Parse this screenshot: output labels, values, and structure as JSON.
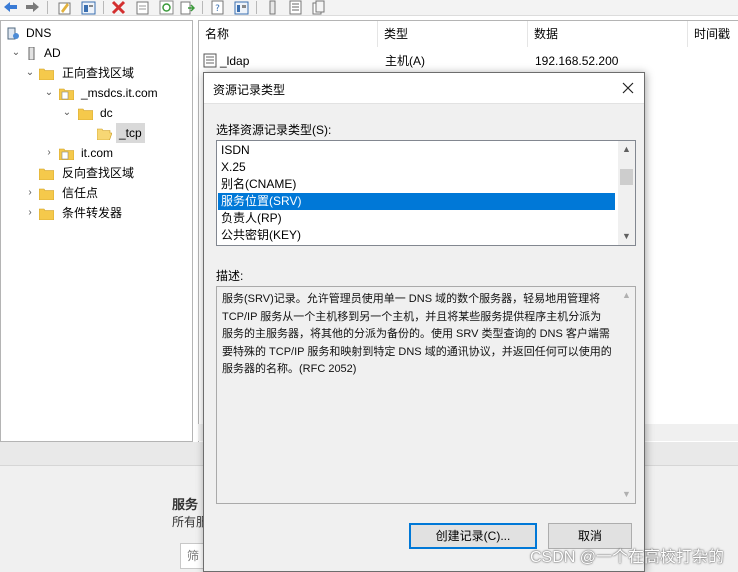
{
  "toolbar": {
    "icons": [
      "back-arrow-icon",
      "forward-arrow-icon",
      "edit-icon",
      "properties-icon",
      "delete-icon",
      "export-icon",
      "refresh-icon",
      "export-list-icon",
      "help-icon",
      "server-icon",
      "list-icon",
      "copy-icon"
    ]
  },
  "tree": {
    "items": [
      {
        "label": "DNS"
      },
      {
        "label": "AD"
      },
      {
        "label": "正向查找区域"
      },
      {
        "label": "_msdcs.it.com"
      },
      {
        "label": "dc"
      },
      {
        "label": "_tcp"
      },
      {
        "label": "it.com"
      },
      {
        "label": "反向查找区域"
      },
      {
        "label": "信任点"
      },
      {
        "label": "条件转发器"
      }
    ]
  },
  "list": {
    "columns": [
      "名称",
      "类型",
      "数据",
      "时间戳"
    ],
    "rows": [
      {
        "name": "_ldap",
        "type": "主机(A)",
        "data": "192.168.52.200"
      }
    ]
  },
  "bottom": {
    "heading": "服务",
    "subtext": "所有服",
    "input_placeholder": "筛"
  },
  "dialog": {
    "title": "资源记录类型",
    "select_label": "选择资源记录类型(S):",
    "record_types": [
      "ISDN",
      "X.25",
      "别名(CNAME)",
      "服务位置(SRV)",
      "负责人(RP)",
      "公共密钥(KEY)"
    ],
    "selected_type": "服务位置(SRV)",
    "desc_label": "描述:",
    "description": "服务(SRV)记录。允许管理员使用单一 DNS 域的数个服务器，轻易地用管理将 TCP/IP 服务从一个主机移到另一个主机，并且将某些服务提供程序主机分派为服务的主服务器，将其他的分派为备份的。使用 SRV 类型查询的 DNS 客户端需要特殊的 TCP/IP 服务和映射到特定 DNS 域的通讯协议，并返回任何可以使用的服务器的名称。(RFC 2052)",
    "create_button": "创建记录(C)...",
    "cancel_button": "取消"
  },
  "watermark": "CSDN @一个在高校打杂的",
  "colors": {
    "selection": "#0078d7",
    "tree_selection": "#d9d9d9",
    "folder": "#f5c94b",
    "delete_red": "#d32f2f"
  }
}
